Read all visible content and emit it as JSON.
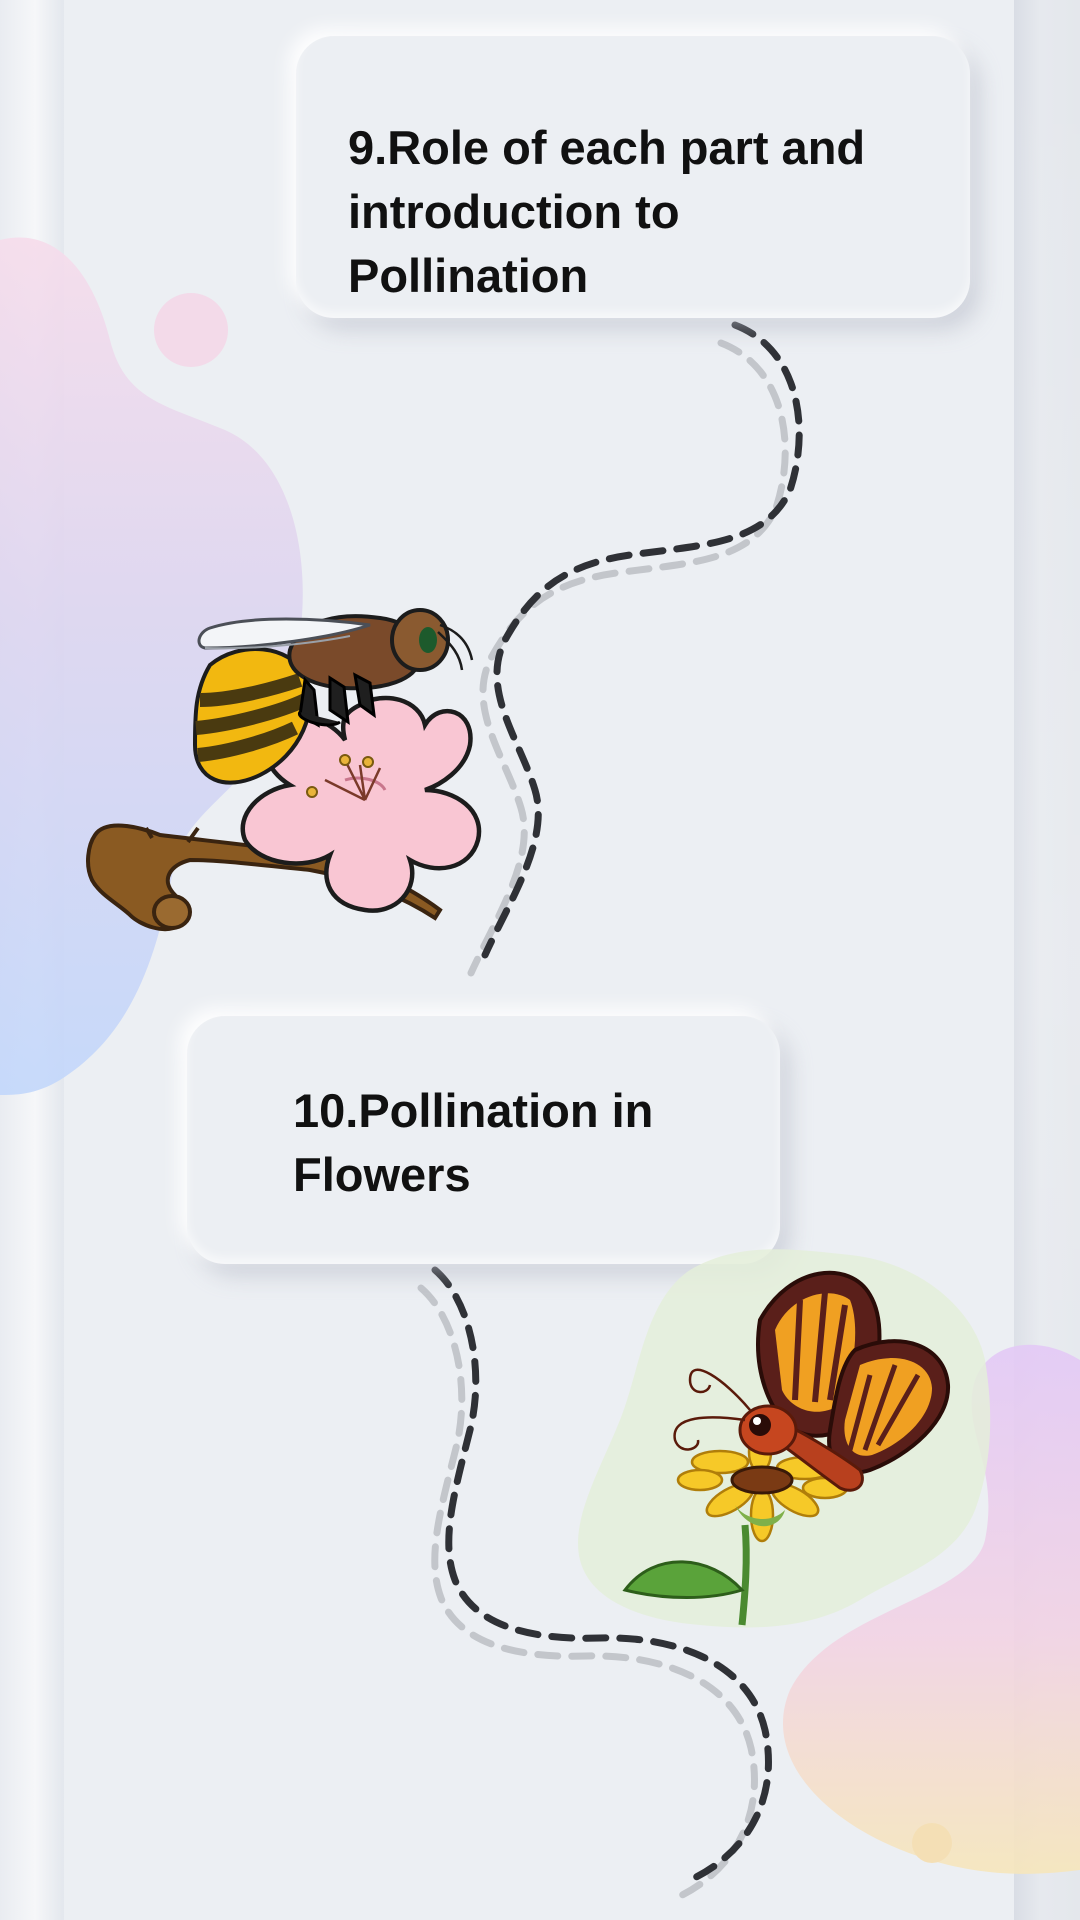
{
  "lessons": [
    {
      "title": "9.Role of each part and\nintroduction to\nPollination",
      "illustration": "bee-on-flower-illustration"
    },
    {
      "title": "10.Pollination in\nFlowers",
      "illustration": "butterfly-on-sunflower-illustration"
    }
  ],
  "colors": {
    "background": "#eceff3",
    "path_dark": "#2f3136",
    "path_light": "#c3c6cb",
    "blob_pink": "#f3dbe8",
    "blob_blue": "#c7d8f7",
    "blob_purple": "#e1cdf3",
    "blob_yellow": "#f5e4b8"
  }
}
